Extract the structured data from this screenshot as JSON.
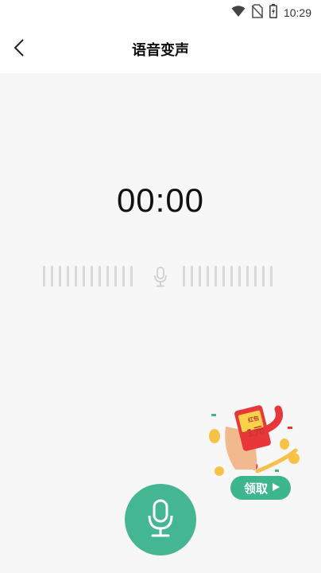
{
  "status_bar": {
    "time": "10:29",
    "icons": [
      "wifi-icon",
      "no-sim-icon",
      "battery-charging-icon"
    ]
  },
  "header": {
    "title": "语音变声",
    "back_icon": "back-arrow-icon"
  },
  "recorder": {
    "timer": "00:00",
    "waveform_icon": "microphone-icon",
    "record_button_icon": "microphone-icon"
  },
  "promo": {
    "card_small_text": "红包",
    "card_amount": "1元",
    "button_label": "领取",
    "button_icon": "play-triangle-icon"
  },
  "colors": {
    "accent": "#44b792",
    "background": "#f7f7f7",
    "promo_red": "#e8363a",
    "promo_yellow": "#f8d24a"
  }
}
